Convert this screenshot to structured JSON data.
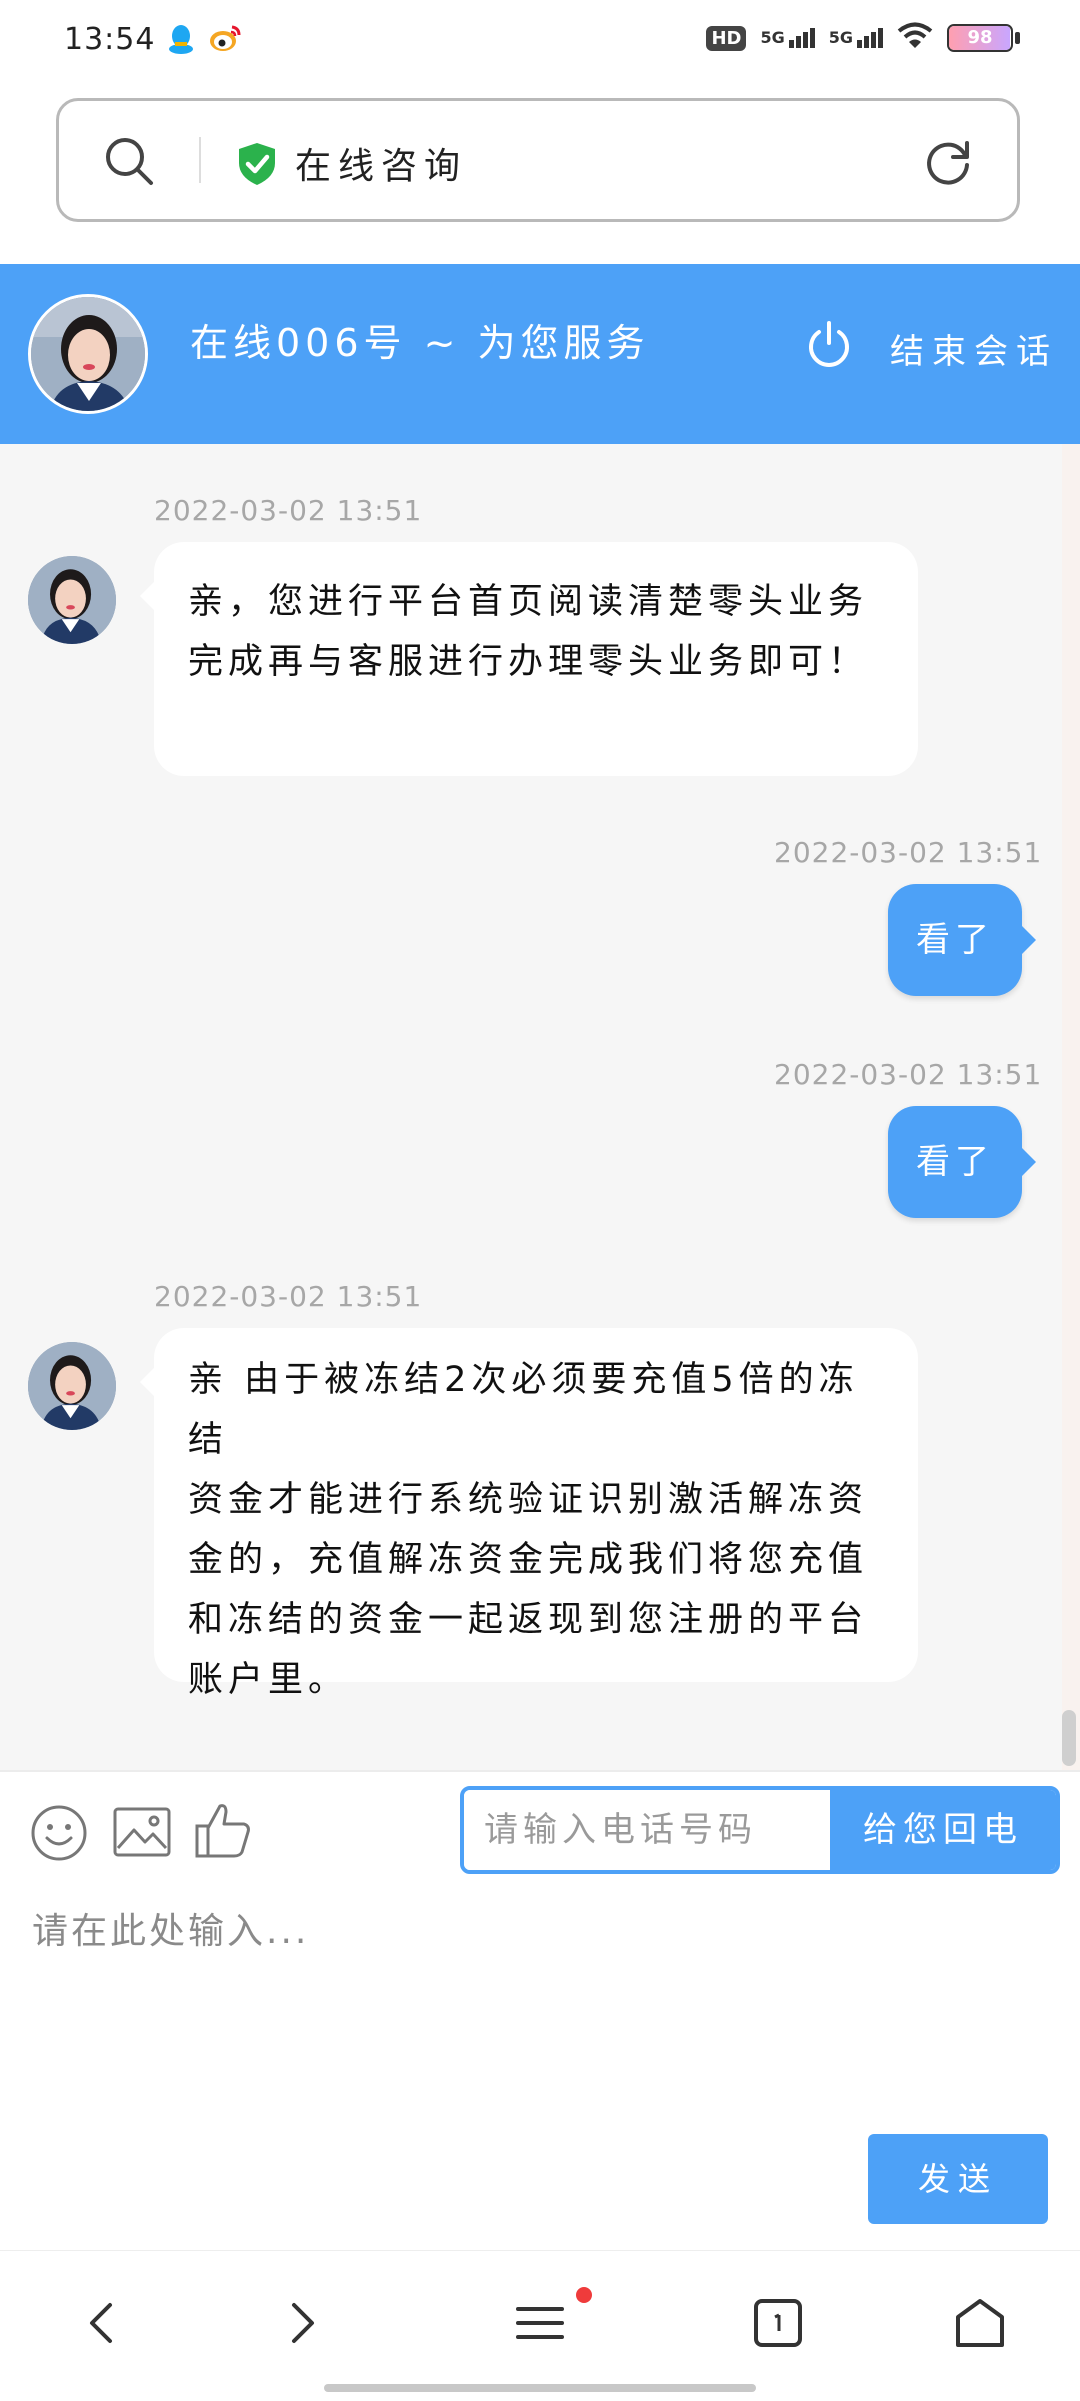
{
  "status_bar": {
    "time": "13:54",
    "hd_label": "HD",
    "network_1": "5G",
    "network_2": "5G",
    "battery_level": 98,
    "battery_text": "98"
  },
  "url_bar": {
    "title": "在线咨询"
  },
  "chat_header": {
    "agent_title": "在线006号 ~ 为您服务",
    "end_session_label": "结束会话"
  },
  "messages": [
    {
      "side": "agent",
      "time": "2022-03-02 13:51",
      "lines": [
        "亲，您进行平台首页阅读清楚零头业务",
        "完成再与客服进行办理零头业务即可！"
      ]
    },
    {
      "side": "user",
      "time": "2022-03-02 13:51",
      "text": "看了"
    },
    {
      "side": "user",
      "time": "2022-03-02 13:51",
      "text": "看了"
    },
    {
      "side": "agent",
      "time": "2022-03-02 13:51",
      "lines": [
        "亲 由于被冻结2次必须要充值5倍的冻结",
        "资金才能进行系统验证识别激活解冻资",
        "金的，充值解冻资金完成我们将您充值",
        "和冻结的资金一起返现到您注册的平台",
        "账户里。"
      ]
    }
  ],
  "input_panel": {
    "phone_placeholder": "请输入电话号码",
    "callback_label": "给您回电",
    "message_placeholder": "请在此处输入...",
    "send_label": "发送"
  },
  "colors": {
    "accent": "#4da1f7",
    "shield": "#2bb24c",
    "notification_dot": "#ef3b3b"
  },
  "icons": [
    "search-icon",
    "shield-check-icon",
    "refresh-icon",
    "power-icon",
    "emoji-icon",
    "image-icon",
    "thumbs-up-icon",
    "back-icon",
    "forward-icon",
    "menu-icon",
    "tabs-icon",
    "home-icon"
  ]
}
